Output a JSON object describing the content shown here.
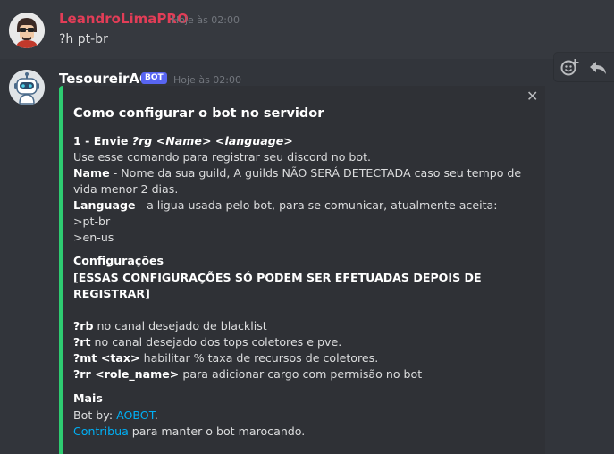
{
  "message1": {
    "author": "LeandroLimaPRO",
    "timestamp": "Hoje às 02:00",
    "content": "?h pt-br"
  },
  "message2": {
    "author": "TesoureirAO",
    "bot_tag": "BOT",
    "timestamp": "Hoje às 02:00"
  },
  "hover_actions": {
    "react_icon": "add-reaction-icon",
    "reply_icon": "reply-icon"
  },
  "embed": {
    "accent_color": "#2ecc71",
    "close_glyph": "✕",
    "title": "Como configurar o bot no servidor",
    "step1_prefix": "1 - Envie ",
    "step1_command": "?rg <Name> <language>",
    "step1_desc": "Use esse comando para registrar seu discord no bot.",
    "name_label": "Name",
    "name_desc_1": " - Nome da sua guild, A guilds NÃO SERÁ DETECTADA caso seu tempo de",
    "name_desc_2": "vida menor 2 dias.",
    "language_label": "Language",
    "language_desc": " - a ligua usada pelo bot, para se comunicar, atualmente aceita:",
    "lang_option_1": ">pt-br",
    "lang_option_2": ">en-us",
    "config_title": "Configurações",
    "config_warning_1": "[ESSAS CONFIGURAÇÕES SÓ PODEM SER EFETUADAS DEPOIS DE",
    "config_warning_2": "REGISTRAR]",
    "cmd_rb": "?rb",
    "cmd_rb_desc": " no canal desejado de blacklist",
    "cmd_rt": "?rt",
    "cmd_rt_desc": " no canal desejado dos tops coletores e pve.",
    "cmd_mt": "?mt <tax>",
    "cmd_mt_desc": " habilitar % taxa de recursos de coletores.",
    "cmd_rr": "?rr <role_name>",
    "cmd_rr_desc": " para adicionar cargo com permisão no bot",
    "mais_title": "Mais",
    "botby_prefix": "Bot by: ",
    "botby_link": "AOBOT",
    "botby_suffix": ".",
    "contribua_link": "Contribua",
    "contribua_suffix": " para manter o bot marocando."
  }
}
